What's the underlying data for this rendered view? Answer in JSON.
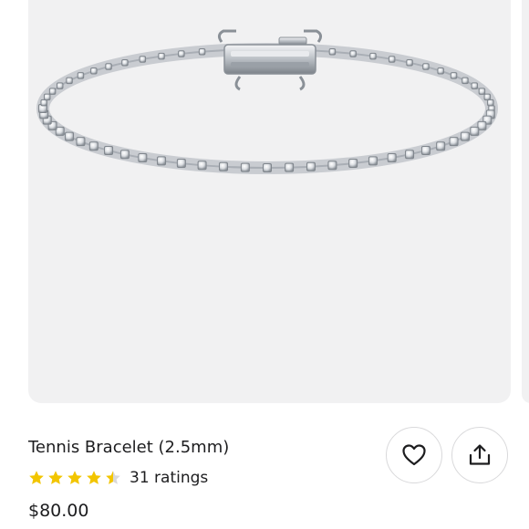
{
  "product": {
    "title": "Tennis Bracelet (2.5mm)",
    "rating_stars": 4.5,
    "ratings_count_label": "31 ratings",
    "price": "$80.00"
  },
  "colors": {
    "star": "#f2c500",
    "star_empty": "#d9d9d9",
    "card_background": "#f1f1f2",
    "text": "#1d1d1f"
  },
  "icons": {
    "favorite": "heart-icon",
    "share": "share-icon"
  }
}
